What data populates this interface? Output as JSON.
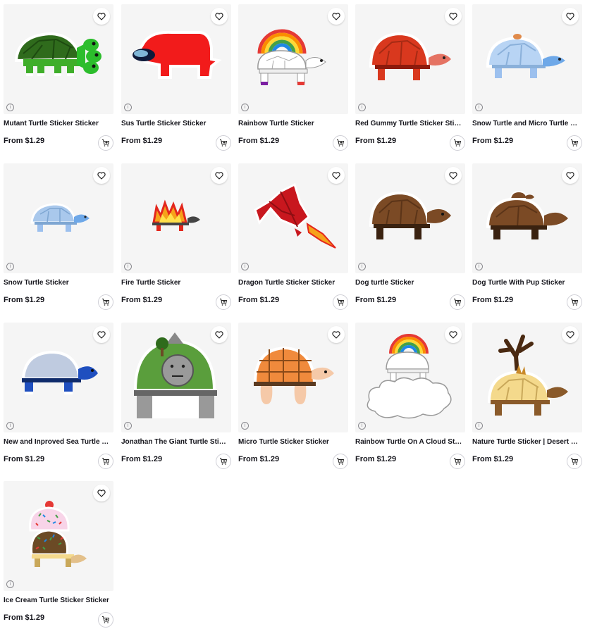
{
  "products": [
    {
      "title": "Mutant Turtle Sticker Sticker",
      "price": "From $1.29",
      "art": "mutant-turtle"
    },
    {
      "title": "Sus Turtle Sticker Sticker",
      "price": "From $1.29",
      "art": "sus-turtle"
    },
    {
      "title": "Rainbow Turtle Sticker",
      "price": "From $1.29",
      "art": "rainbow-turtle"
    },
    {
      "title": "Red Gummy Turtle Sticker Sticker",
      "price": "From $1.29",
      "art": "red-gummy-turtle"
    },
    {
      "title": "Snow Turtle and Micro Turtle Sti...",
      "price": "From $1.29",
      "art": "snow-and-micro-turtle"
    },
    {
      "title": "Snow Turtle Sticker",
      "price": "From $1.29",
      "art": "snow-turtle"
    },
    {
      "title": "Fire Turtle Sticker",
      "price": "From $1.29",
      "art": "fire-turtle"
    },
    {
      "title": "Dragon Turtle Sticker Sticker",
      "price": "From $1.29",
      "art": "dragon-turtle"
    },
    {
      "title": "Dog turtle Sticker",
      "price": "From $1.29",
      "art": "dog-turtle"
    },
    {
      "title": "Dog Turtle With Pup Sticker",
      "price": "From $1.29",
      "art": "dog-turtle-with-pup"
    },
    {
      "title": "New and Inproved Sea Turtle Sti...",
      "price": "From $1.29",
      "art": "sea-turtle"
    },
    {
      "title": "Jonathan The Giant Turtle Sticker",
      "price": "From $1.29",
      "art": "giant-turtle"
    },
    {
      "title": "Micro Turtle Sticker Sticker",
      "price": "From $1.29",
      "art": "micro-turtle"
    },
    {
      "title": "Rainbow Turtle On A Cloud Sticker",
      "price": "From $1.29",
      "art": "rainbow-turtle-cloud"
    },
    {
      "title": "Nature Turtle Sticker | Desert Sti...",
      "price": "From $1.29",
      "art": "nature-turtle"
    },
    {
      "title": "Ice Cream Turtle Sticker Sticker",
      "price": "From $1.29",
      "art": "ice-cream-turtle"
    }
  ],
  "icons": {
    "favorite": "heart-icon",
    "add_to_cart": "cart-plus-icon",
    "info": "info-icon"
  },
  "colors": {
    "thumb_bg": "#f5f5f5",
    "text": "#15151c"
  }
}
